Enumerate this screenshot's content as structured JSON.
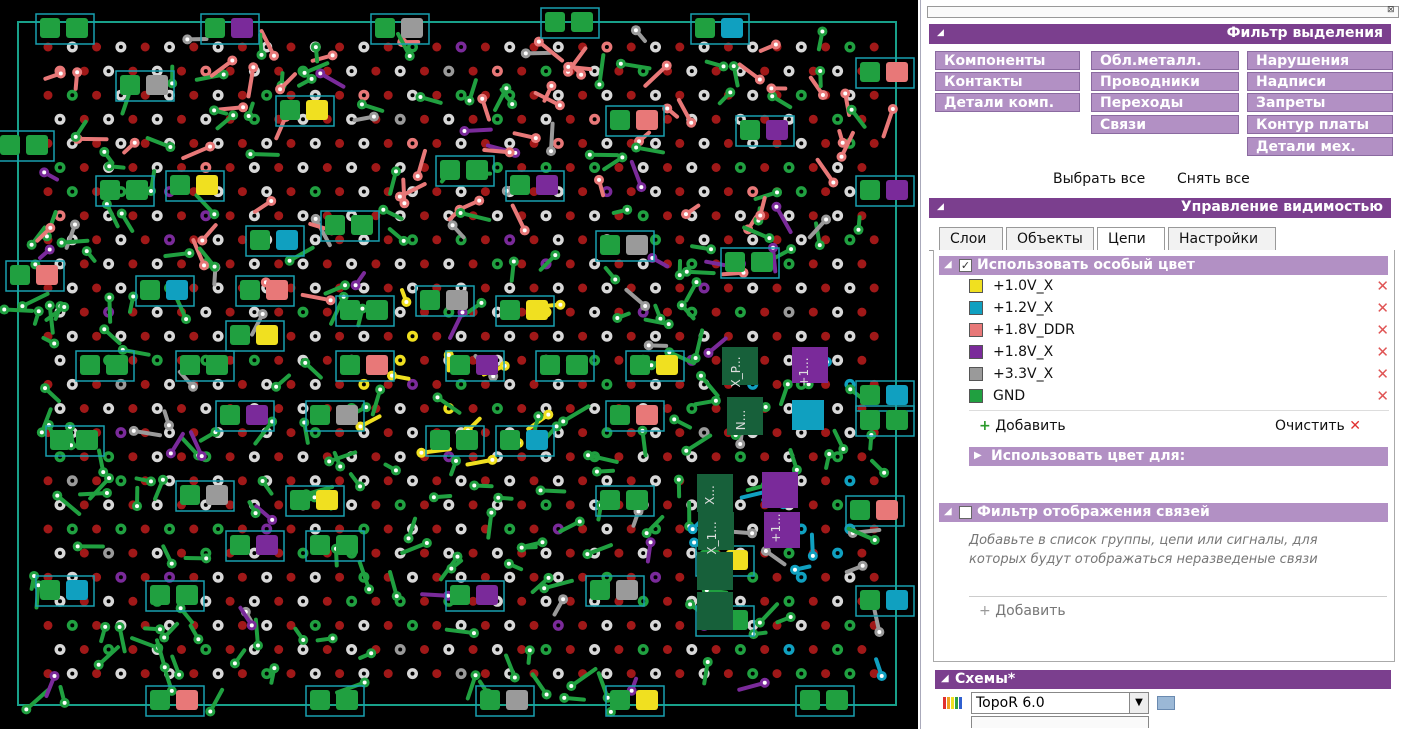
{
  "colors": {
    "board_outline": "#18a08a",
    "background": "#000000",
    "via_red": "#a01818",
    "pad_white": "#d8d8d8",
    "net_1v0": "#f0e020",
    "net_1v2": "#10a0c0",
    "net_1v8ddr": "#e87878",
    "net_1v8": "#7a2a9a",
    "net_3v3": "#9a9a9a",
    "net_gnd": "#20a040",
    "gnd_dark": "#17603a",
    "panel_header": "#7b3f8e",
    "panel_button": "#b290c4"
  },
  "selection_filter": {
    "title": "Фильтр выделения",
    "col1": [
      "Компоненты",
      "Контакты",
      "Детали комп."
    ],
    "col2": [
      "Обл.металл.",
      "Проводники",
      "Переходы",
      "Связи"
    ],
    "col3": [
      "Нарушения",
      "Надписи",
      "Запреты",
      "Контур платы",
      "Детали мех."
    ],
    "select_all": "Выбрать все",
    "deselect_all": "Снять все"
  },
  "visibility": {
    "title": "Управление видимостью",
    "tabs": [
      "Слои",
      "Объекты",
      "Цепи",
      "Настройки"
    ],
    "active_tab": "Цепи",
    "special_color": {
      "label": "Использовать особый цвет",
      "checked_mark": "✓",
      "nets": [
        {
          "name": "+1.0V_X",
          "color": "#f0e020"
        },
        {
          "name": "+1.2V_X",
          "color": "#10a0c0"
        },
        {
          "name": "+1.8V_DDR",
          "color": "#e87878"
        },
        {
          "name": "+1.8V_X",
          "color": "#7a2a9a"
        },
        {
          "name": "+3.3V_X",
          "color": "#9a9a9a"
        },
        {
          "name": "GND",
          "color": "#20a040"
        }
      ],
      "delete_icon": "✕",
      "add_label": "Добавить",
      "clear_label": "Очистить"
    },
    "use_color_for": "Использовать цвет для:",
    "link_filter": {
      "label": "Фильтр отображения связей",
      "hint": "Добавьте в список группы, цепи или сигналы, для которых будут отображаться неразведеные связи",
      "add_label": "Добавить"
    }
  },
  "schemes": {
    "title": "Схемы*",
    "selected": "TopoR 6.0"
  },
  "board": {
    "comp_labels": [
      "X_P...",
      "+1...",
      "N...",
      "X...",
      "+1...",
      "X_1..."
    ]
  }
}
